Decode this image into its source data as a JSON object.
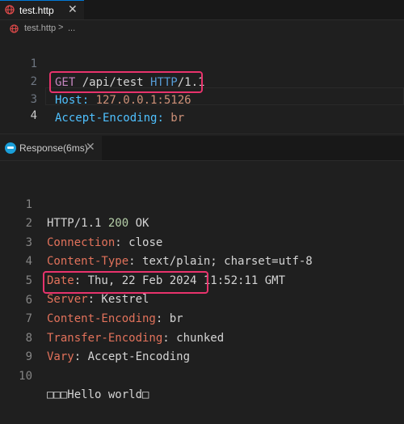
{
  "editor": {
    "tab": {
      "label": "test.http",
      "close": "✕"
    },
    "breadcrumb": {
      "file": "test.http",
      "separator": ">",
      "more": "..."
    },
    "lines": [
      {
        "n": "1",
        "parts": [
          {
            "t": "GET ",
            "c": "method"
          },
          {
            "t": "/api/test ",
            "c": "plain"
          },
          {
            "t": "HTTP",
            "c": "proto"
          },
          {
            "t": "/1.1",
            "c": "proto2"
          }
        ]
      },
      {
        "n": "2",
        "parts": [
          {
            "t": "Host",
            "c": "key"
          },
          {
            "t": ": ",
            "c": "key"
          },
          {
            "t": "127.0.0.1:5126",
            "c": "val"
          }
        ]
      },
      {
        "n": "3",
        "parts": [
          {
            "t": "Accept-Encoding",
            "c": "key"
          },
          {
            "t": ": ",
            "c": "key"
          },
          {
            "t": "br",
            "c": "val"
          }
        ]
      },
      {
        "n": "4",
        "parts": []
      }
    ]
  },
  "response": {
    "tab": {
      "label": "Response(6ms)",
      "close": "✕"
    },
    "lines": [
      {
        "n": "1",
        "parts": [
          {
            "t": "HTTP/1.1 ",
            "c": "plain"
          },
          {
            "t": "200",
            "c": "status"
          },
          {
            "t": " OK",
            "c": "plain"
          }
        ]
      },
      {
        "n": "2",
        "parts": [
          {
            "t": "Connection",
            "c": "key"
          },
          {
            "t": ": close",
            "c": "plain"
          }
        ]
      },
      {
        "n": "3",
        "parts": [
          {
            "t": "Content-Type",
            "c": "key"
          },
          {
            "t": ": text/plain; charset=utf-8",
            "c": "plain"
          }
        ]
      },
      {
        "n": "4",
        "parts": [
          {
            "t": "Date",
            "c": "key"
          },
          {
            "t": ": Thu, 22 Feb 2024 11:52:11 GMT",
            "c": "plain"
          }
        ]
      },
      {
        "n": "5",
        "parts": [
          {
            "t": "Server",
            "c": "key"
          },
          {
            "t": ": Kestrel",
            "c": "plain"
          }
        ]
      },
      {
        "n": "6",
        "parts": [
          {
            "t": "Content-Encoding",
            "c": "key"
          },
          {
            "t": ": br",
            "c": "plain"
          }
        ]
      },
      {
        "n": "7",
        "parts": [
          {
            "t": "Transfer-Encoding",
            "c": "key"
          },
          {
            "t": ": chunked",
            "c": "plain"
          }
        ]
      },
      {
        "n": "8",
        "parts": [
          {
            "t": "Vary",
            "c": "key"
          },
          {
            "t": ": Accept-Encoding",
            "c": "plain"
          }
        ]
      },
      {
        "n": "9",
        "parts": []
      },
      {
        "n": "10",
        "parts": [
          {
            "t": "□□□Hello world□",
            "c": "plain"
          }
        ]
      }
    ]
  },
  "colors": {
    "highlight_box": "#e8336c",
    "editor_bg": "#1f1f1f",
    "tab_active_border": "#0078d4"
  }
}
